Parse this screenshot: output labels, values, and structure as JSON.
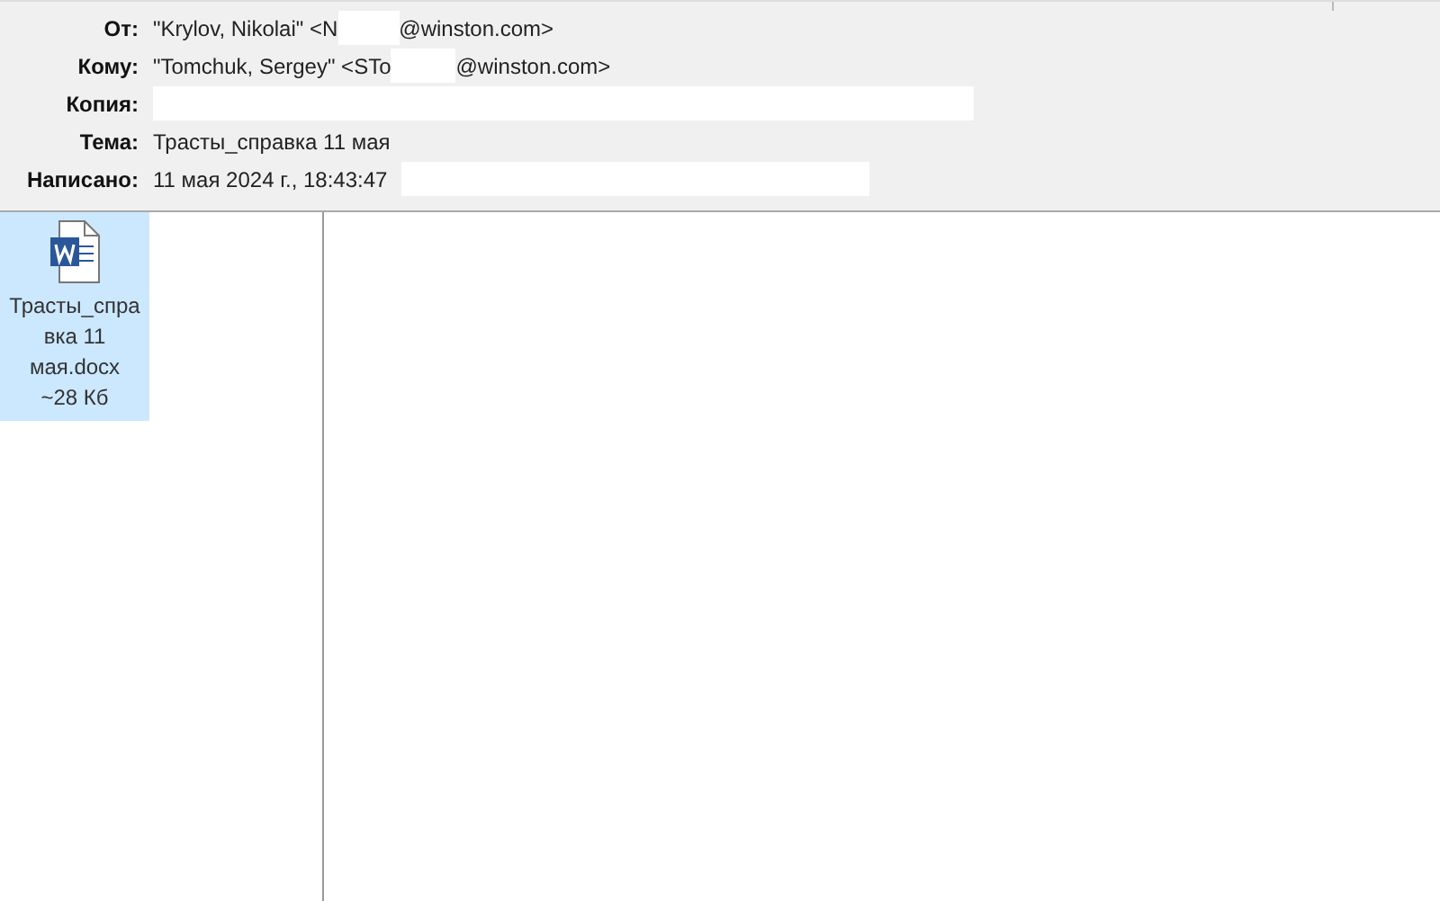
{
  "header": {
    "fields": [
      {
        "label": "От:",
        "parts": [
          "\"Krylov, Nikolai\" <N",
          "@winston.com>"
        ]
      },
      {
        "label": "Кому:",
        "parts": [
          "\"Tomchuk, Sergey\" <STo",
          "@winston.com>"
        ]
      },
      {
        "label": "Копия:"
      },
      {
        "label": "Тема:",
        "parts": [
          "Трасты_справка 11 мая"
        ]
      },
      {
        "label": "Написано:",
        "parts": [
          "11 мая 2024 г., 18:43:47"
        ]
      }
    ]
  },
  "attachments": [
    {
      "name": "Трасты_справка 11 мая.docx",
      "size": "~28 Кб",
      "selected": true
    }
  ]
}
